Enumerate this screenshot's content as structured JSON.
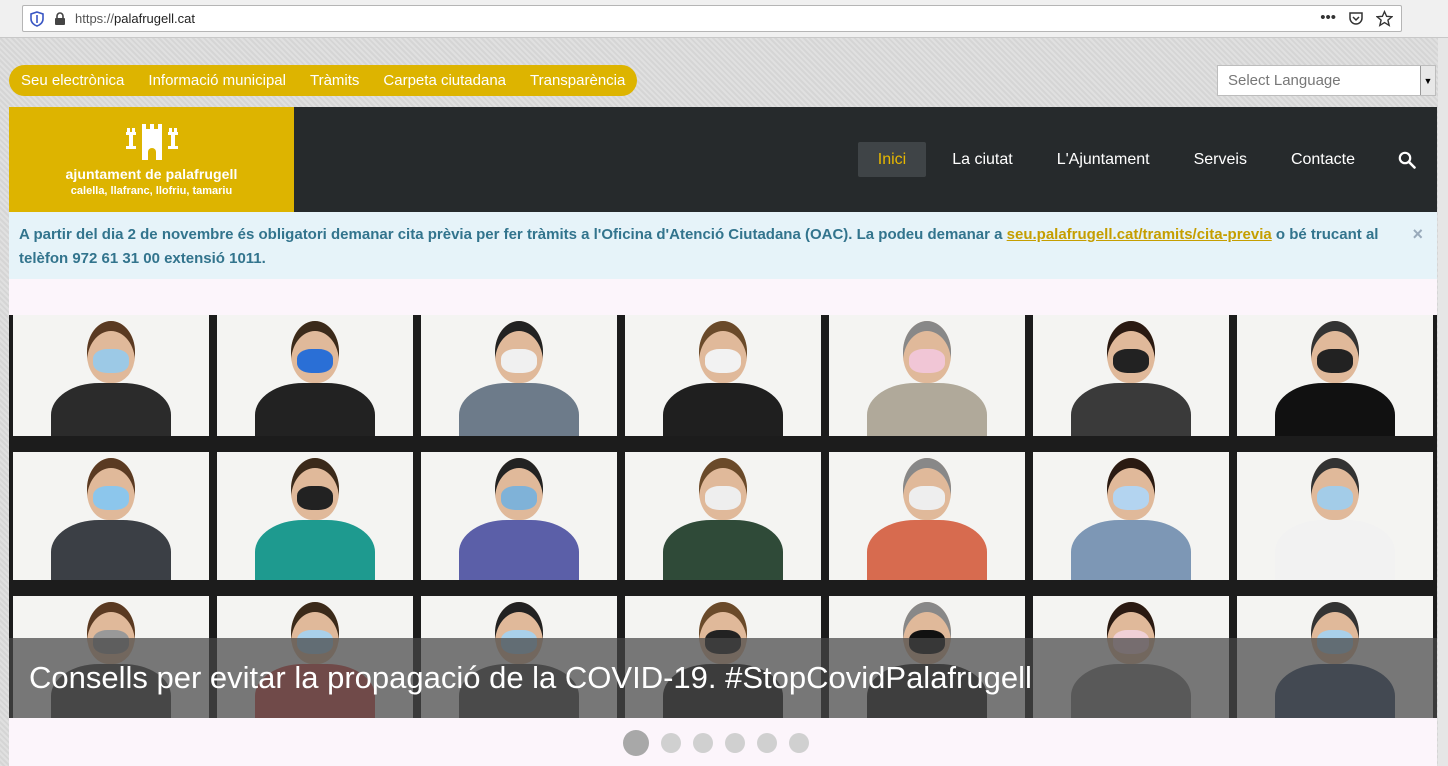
{
  "browser": {
    "url_proto": "https://",
    "url_host": "palafrugell.cat",
    "icons": [
      "shield-icon",
      "lock-icon",
      "more-icon",
      "pocket-icon",
      "bookmark-star-icon"
    ]
  },
  "utility_nav": {
    "items": [
      "Seu electrònica",
      "Informació municipal",
      "Tràmits",
      "Carpeta ciutadana",
      "Transparència"
    ]
  },
  "language_select": {
    "value": "Select Language"
  },
  "logo": {
    "line1": "ajuntament de palafrugell",
    "line2": "calella, llafranc, llofriu, tamariu"
  },
  "main_nav": {
    "items": [
      "Inici",
      "La ciutat",
      "L'Ajuntament",
      "Serveis",
      "Contacte"
    ],
    "active": "Inici"
  },
  "notice": {
    "text_before": "A partir del dia 2 de novembre és obligatori demanar cita prèvia per fer tràmits a l'Oficina d'Atenció Ciutadana (OAC). La podeu demanar a ",
    "link": "seu.palafrugell.cat/tramits/cita-previa",
    "text_after": " o bé trucant al telèfon 972 61 31 00 extensió 1011.",
    "close": "×"
  },
  "slider": {
    "caption": "Consells per evitar la propagació de la COVID-19. #StopCovidPalafrugell",
    "dot_count": 6,
    "active_dot": 1
  },
  "colors": {
    "brand_yellow": "#ddb400",
    "header_dark": "#262a2c",
    "notice_bg": "#e6f3f9",
    "notice_text": "#32748d"
  }
}
